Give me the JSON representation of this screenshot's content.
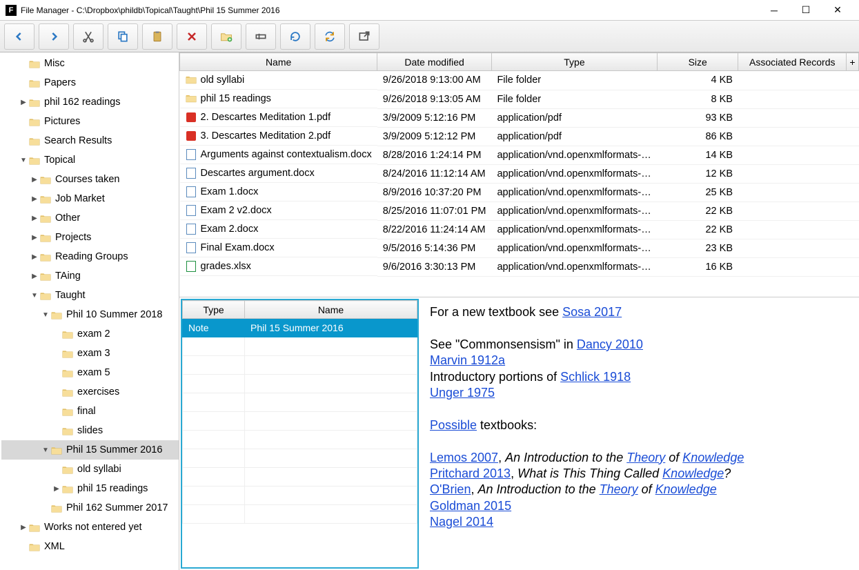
{
  "window": {
    "title": "File Manager - C:\\Dropbox\\phildb\\Topical\\Taught\\Phil 15 Summer 2016"
  },
  "toolbar_icons": [
    "back",
    "forward",
    "cut",
    "copy",
    "paste",
    "delete",
    "new-folder",
    "rename",
    "refresh",
    "refresh-all",
    "open-external"
  ],
  "tree": [
    {
      "d": 1,
      "exp": null,
      "label": "Misc"
    },
    {
      "d": 1,
      "exp": null,
      "label": "Papers"
    },
    {
      "d": 1,
      "exp": "closed",
      "label": "phil 162 readings"
    },
    {
      "d": 1,
      "exp": null,
      "label": "Pictures"
    },
    {
      "d": 1,
      "exp": null,
      "label": "Search Results"
    },
    {
      "d": 1,
      "exp": "open",
      "label": "Topical"
    },
    {
      "d": 2,
      "exp": "closed",
      "label": "Courses taken"
    },
    {
      "d": 2,
      "exp": "closed",
      "label": "Job Market"
    },
    {
      "d": 2,
      "exp": "closed",
      "label": "Other"
    },
    {
      "d": 2,
      "exp": "closed",
      "label": "Projects"
    },
    {
      "d": 2,
      "exp": "closed",
      "label": "Reading Groups"
    },
    {
      "d": 2,
      "exp": "closed",
      "label": "TAing"
    },
    {
      "d": 2,
      "exp": "open",
      "label": "Taught"
    },
    {
      "d": 3,
      "exp": "open",
      "label": "Phil 10 Summer 2018"
    },
    {
      "d": 4,
      "exp": null,
      "label": "exam 2"
    },
    {
      "d": 4,
      "exp": null,
      "label": "exam 3"
    },
    {
      "d": 4,
      "exp": null,
      "label": "exam 5"
    },
    {
      "d": 4,
      "exp": null,
      "label": "exercises"
    },
    {
      "d": 4,
      "exp": null,
      "label": "final"
    },
    {
      "d": 4,
      "exp": null,
      "label": "slides"
    },
    {
      "d": 3,
      "exp": "open",
      "label": "Phil 15 Summer 2016",
      "selected": true
    },
    {
      "d": 4,
      "exp": null,
      "label": "old syllabi"
    },
    {
      "d": 4,
      "exp": "closed",
      "label": "phil 15 readings"
    },
    {
      "d": 3,
      "exp": null,
      "label": "Phil 162 Summer 2017"
    },
    {
      "d": 1,
      "exp": "closed",
      "label": "Works not entered yet"
    },
    {
      "d": 1,
      "exp": null,
      "label": "XML"
    }
  ],
  "file_headers": {
    "name": "Name",
    "date": "Date modified",
    "type": "Type",
    "size": "Size",
    "assoc": "Associated Records"
  },
  "files": [
    {
      "icon": "folder",
      "name": "old syllabi",
      "date": "9/26/2018 9:13:00 AM",
      "type": "File folder",
      "size": "4 KB"
    },
    {
      "icon": "folder",
      "name": "phil 15 readings",
      "date": "9/26/2018 9:13:05 AM",
      "type": "File folder",
      "size": "8 KB"
    },
    {
      "icon": "pdf",
      "name": "2. Descartes Meditation 1.pdf",
      "date": "3/9/2009 5:12:16 PM",
      "type": "application/pdf",
      "size": "93 KB"
    },
    {
      "icon": "pdf",
      "name": "3. Descartes Meditation 2.pdf",
      "date": "3/9/2009 5:12:12 PM",
      "type": "application/pdf",
      "size": "86 KB"
    },
    {
      "icon": "doc",
      "name": "Arguments against contextualism.docx",
      "date": "8/28/2016 1:24:14 PM",
      "type": "application/vnd.openxmlformats-o...",
      "size": "14 KB"
    },
    {
      "icon": "doc",
      "name": "Descartes argument.docx",
      "date": "8/24/2016 11:12:14 AM",
      "type": "application/vnd.openxmlformats-o...",
      "size": "12 KB"
    },
    {
      "icon": "doc",
      "name": "Exam 1.docx",
      "date": "8/9/2016 10:37:20 PM",
      "type": "application/vnd.openxmlformats-o...",
      "size": "25 KB"
    },
    {
      "icon": "doc",
      "name": "Exam 2 v2.docx",
      "date": "8/25/2016 11:07:01 PM",
      "type": "application/vnd.openxmlformats-o...",
      "size": "22 KB"
    },
    {
      "icon": "doc",
      "name": "Exam 2.docx",
      "date": "8/22/2016 11:24:14 AM",
      "type": "application/vnd.openxmlformats-o...",
      "size": "22 KB"
    },
    {
      "icon": "doc",
      "name": "Final Exam.docx",
      "date": "9/5/2016 5:14:36 PM",
      "type": "application/vnd.openxmlformats-o...",
      "size": "23 KB"
    },
    {
      "icon": "xls",
      "name": "grades.xlsx",
      "date": "9/6/2016 3:30:13 PM",
      "type": "application/vnd.openxmlformats-o...",
      "size": "16 KB"
    }
  ],
  "record_headers": {
    "type": "Type",
    "name": "Name"
  },
  "records": [
    {
      "type": "Note",
      "name": "Phil 15 Summer 2016",
      "selected": true
    }
  ],
  "note": {
    "line1_pre": "For a new textbook see ",
    "line1_link": "Sosa 2017",
    "line2_pre": "See \"Commonsensism\" in ",
    "line2_link": "Dancy 2010",
    "line3_link": "Marvin 1912a",
    "line4_pre": "Introductory portions of ",
    "line4_link": "Schlick 1918",
    "line5_link": "Unger 1975",
    "line6_link": "Possible",
    "line6_post": " textbooks:",
    "l7a": "Lemos 2007",
    "l7b": ", ",
    "l7c": "An Introduction to the ",
    "l7d": "Theory",
    "l7e": " of ",
    "l7f": "Knowledge",
    "l8a": "Pritchard 2013",
    "l8b": ", ",
    "l8c": "What is This Thing Called ",
    "l8d": "Knowledge",
    "l8e": "?",
    "l9a": "O'Brien",
    "l9b": ", ",
    "l9c": "An Introduction to the ",
    "l9d": "Theory",
    "l9e": " of ",
    "l9f": "Knowledge",
    "l10": "Goldman 2015",
    "l11": "Nagel 2014"
  }
}
